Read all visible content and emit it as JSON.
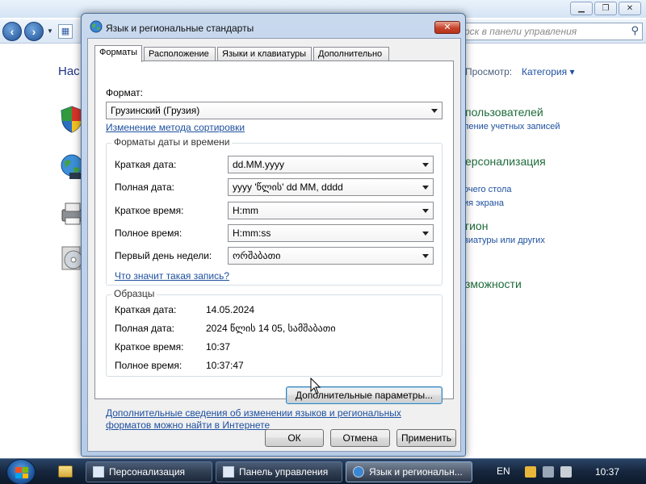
{
  "control_panel": {
    "search_placeholder": "рск в панели управления",
    "left_title": "Нас",
    "view_label": "Просмотр:",
    "view_value": "Категория",
    "sections": [
      {
        "heading": "пользователей",
        "link": "ление учетных записей"
      },
      {
        "heading": "ерсонализация",
        "link": "очего стола"
      },
      {
        "heading": "",
        "link": "ия экрана"
      },
      {
        "heading": "гион",
        "link": "виатуры или других"
      },
      {
        "heading": "зможности",
        "link": ""
      }
    ]
  },
  "dialog": {
    "title": "Язык и региональные стандарты",
    "close_label": "✕",
    "tabs": [
      {
        "label": "Форматы",
        "active": true
      },
      {
        "label": "Расположение",
        "active": false
      },
      {
        "label": "Языки и клавиатуры",
        "active": false
      },
      {
        "label": "Дополнительно",
        "active": false
      }
    ],
    "format_label": "Формат:",
    "format_value": "Грузинский (Грузия)",
    "sort_link": "Изменение метода сортировки",
    "datetime_group": "Форматы даты и времени",
    "fields": [
      {
        "label": "Краткая дата:",
        "value": "dd.MM.yyyy"
      },
      {
        "label": "Полная дата:",
        "value": "yyyy 'წლის' dd MM, dddd"
      },
      {
        "label": "Краткое время:",
        "value": "H:mm"
      },
      {
        "label": "Полное время:",
        "value": "H:mm:ss"
      },
      {
        "label": "Первый день недели:",
        "value": "ორშაბათი"
      }
    ],
    "what_means_link": "Что значит такая запись?",
    "samples_group": "Образцы",
    "samples": [
      {
        "label": "Краткая дата:",
        "value": "14.05.2024"
      },
      {
        "label": "Полная дата:",
        "value": "2024 წლის 14 05, სამშაბათი"
      },
      {
        "label": "Краткое время:",
        "value": "10:37"
      },
      {
        "label": "Полное время:",
        "value": "10:37:47"
      }
    ],
    "additional_button": "Дополнительные параметры...",
    "info_link_line1": "Дополнительные сведения об изменении языков и региональных",
    "info_link_line2": "форматов можно найти в Интернете",
    "ok_button": "ОК",
    "cancel_button": "Отмена",
    "apply_button": "Применить"
  },
  "taskbar": {
    "items": [
      {
        "label": "Персонализация",
        "active": false
      },
      {
        "label": "Панель управления",
        "active": false
      },
      {
        "label": "Язык и региональн...",
        "active": true
      }
    ],
    "language": "EN",
    "clock": "10:37"
  }
}
